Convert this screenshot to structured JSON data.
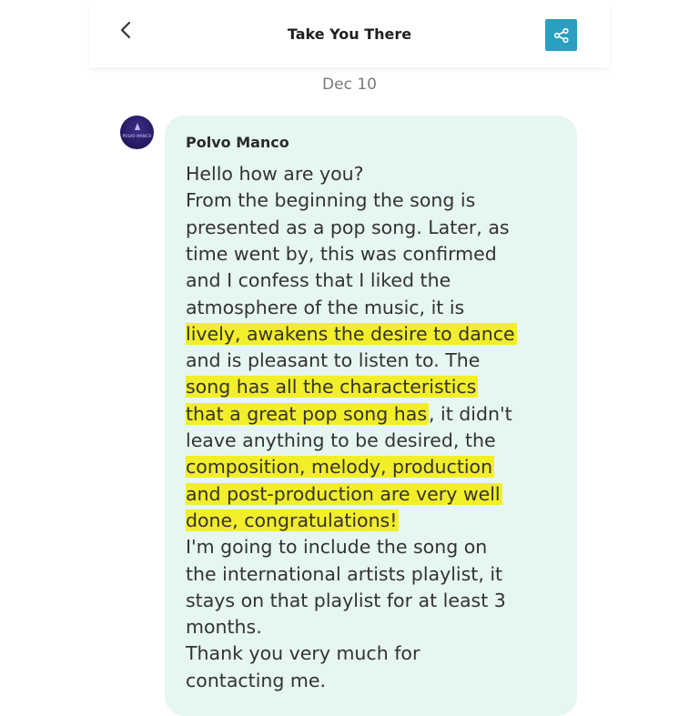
{
  "header": {
    "title": "Take You There"
  },
  "conversation": {
    "date": "Dec 10"
  },
  "message": {
    "sender": "Polvo Manco",
    "avatar_text": "POLVO MANCO",
    "lines": [
      [
        "Hello how are you?"
      ],
      [
        "From the beginning the song is"
      ],
      [
        "presented as a pop song. Later, as"
      ],
      [
        "time went by, this was confirmed"
      ],
      [
        "and I confess that I liked the"
      ],
      [
        "atmosphere of the music, it is"
      ],
      [
        "lively, awakens the desire to dance"
      ],
      [
        "and is pleasant to listen to. The"
      ],
      [
        "song has all the characteristics"
      ],
      [
        "that a great pop song has",
        ", it didn't"
      ],
      [
        "leave anything to be desired, the"
      ],
      [
        "composition, melody, production"
      ],
      [
        "and post-production are very well"
      ],
      [
        "done, congratulations!"
      ],
      [
        "I'm going to include the song on"
      ],
      [
        "the international artists playlist, it"
      ],
      [
        "stays on that playlist for at least 3"
      ],
      [
        "months."
      ],
      [
        "Thank you very much for"
      ],
      [
        "contacting me."
      ]
    ]
  },
  "colors": {
    "bubble": "#e6f6f1",
    "highlight": "#f2ee2a",
    "share_button": "#2a9fbf"
  },
  "icons": {
    "back": "chevron-left-icon",
    "share": "share-icon"
  }
}
